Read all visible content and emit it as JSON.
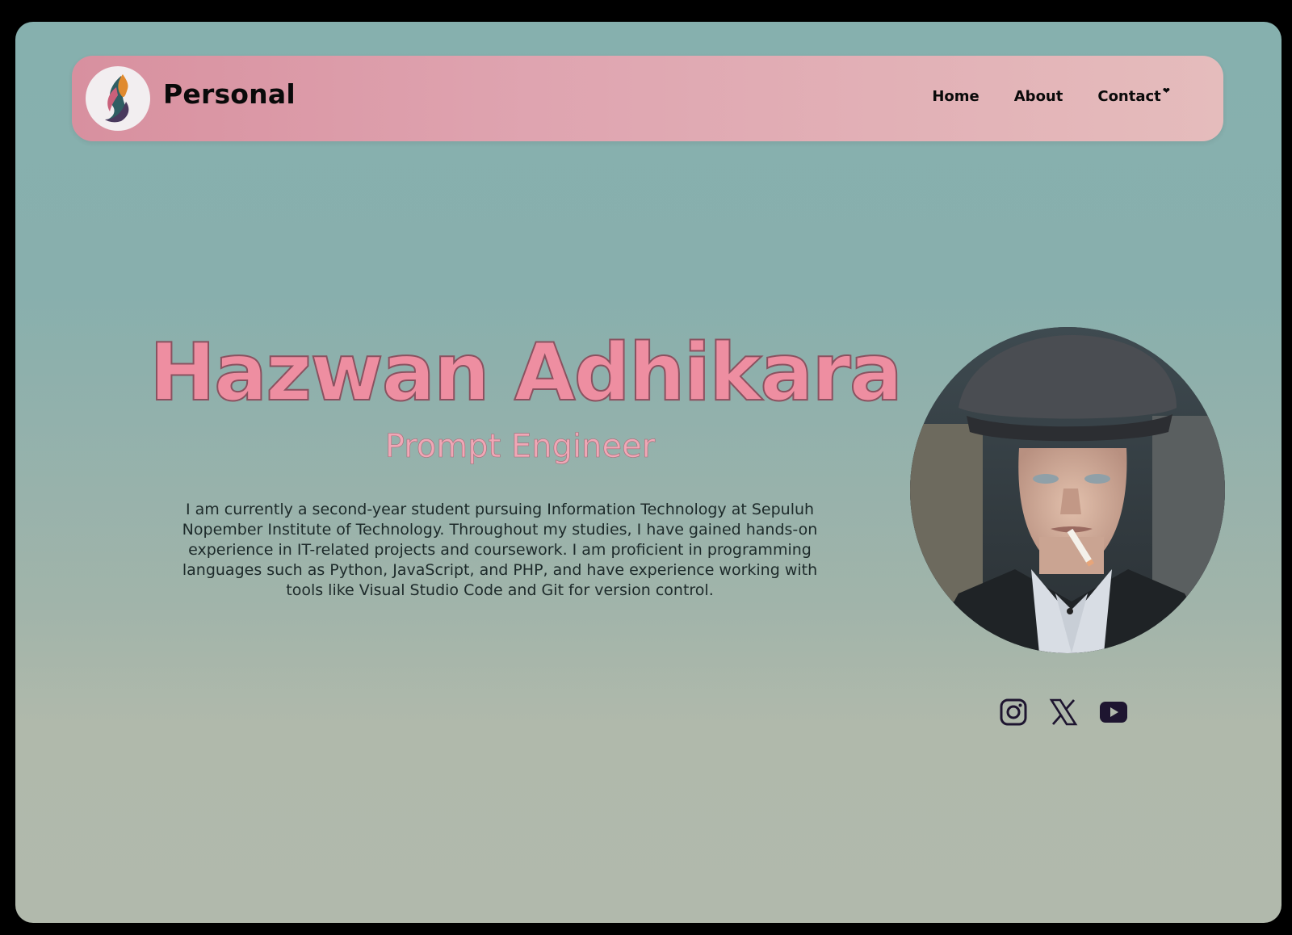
{
  "nav": {
    "brand": "Personal",
    "links": [
      {
        "label": "Home"
      },
      {
        "label": "About"
      },
      {
        "label": "Contact"
      }
    ]
  },
  "hero": {
    "name": "Hazwan Adhikara",
    "role": "Prompt Engineer",
    "bio": "I am currently a second-year student pursuing Information Technology at Sepuluh Nopember Institute of Technology. Throughout my studies, I have gained hands-on experience in IT-related projects and coursework. I am proficient in programming languages such as Python, JavaScript, and PHP, and have experience working with tools like Visual Studio Code and Git for version control."
  },
  "socials": [
    {
      "icon": "instagram-icon"
    },
    {
      "icon": "x-icon"
    },
    {
      "icon": "youtube-icon"
    }
  ],
  "colors": {
    "background_top": "#86b0ae",
    "background_bottom": "#b1b9ac",
    "navbar_start": "#d8909f",
    "navbar_end": "#e5bcbc",
    "name_fill": "#ee8ea1",
    "icon_color": "#1e1530"
  }
}
